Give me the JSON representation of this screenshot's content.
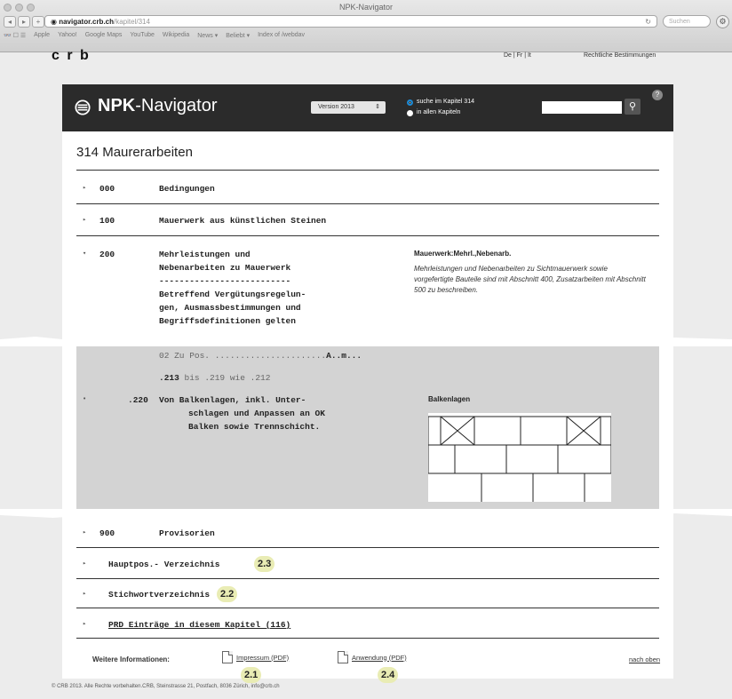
{
  "browser": {
    "window_title": "NPK-Navigator",
    "url_host": "navigator.crb.ch",
    "url_path": "/kapitel/314",
    "search_placeholder": "Suchen",
    "bookmarks": [
      "Apple",
      "Yahoo!",
      "Google Maps",
      "YouTube",
      "Wikipedia",
      "News ▾",
      "Beliebt ▾",
      "Index of /webdav"
    ]
  },
  "site": {
    "logo_text": "c r b",
    "languages": "De | Fr | It",
    "legal_link": "Rechtliche Bestimmungen"
  },
  "header": {
    "app_title_bold": "NPK",
    "app_title_rest": "-Navigator",
    "version_label": "Version 2013",
    "scope_option_1": "suche im Kapitel 314",
    "scope_option_2": "in allen Kapiteln",
    "search_value": ""
  },
  "chapter": {
    "title": "314  Maurerarbeiten",
    "rows": [
      {
        "code": "000",
        "label": "Bedingungen"
      },
      {
        "code": "100",
        "label": "Mauerwerk aus künstlichen Steinen"
      }
    ],
    "expanded": {
      "code": "200",
      "label_lines": [
        "Mehrleistungen und",
        "Nebenarbeiten zu Mauerwerk",
        "--------------------------",
        "Betreffend Vergütungsregelun-",
        "gen, Ausmassbestimmungen und",
        "Begriffsdefinitionen gelten"
      ],
      "desc_title": "Mauerwerk:Mehrl.,Nebenarb.",
      "desc_text": "Mehrleistungen und Nebenarbeiten zu Sichtmauerwerk sowie vorgefertigte Bauteile sind mit Abschnitt 400, Zusatzarbeiten mit Abschnitt 500 zu beschreiben."
    },
    "gray_block": {
      "line1_prefix": "02 Zu Pos. ......................",
      "line1_suffix": "A..m...",
      "line2_code": ".213",
      "line2_rest": "  bis .219 wie .212",
      "item_code": ".220",
      "item_lines": [
        "Von Balkenlagen, inkl. Unter-",
        "schlagen und Anpassen an OK",
        "Balken sowie Trennschicht."
      ],
      "item_desc_title": "Balkenlagen"
    },
    "more_rows": [
      {
        "code": "900",
        "label": "Provisorien"
      }
    ],
    "links": [
      {
        "label": "Hauptpos.- Verzeichnis",
        "badge": "2.3"
      },
      {
        "label": "Stichwortverzeichnis",
        "badge": "2.2"
      },
      {
        "label": "PRD Einträge in diesem Kapitel (116)",
        "badge": ""
      }
    ]
  },
  "footer": {
    "more_info_label": "Weitere Informationen:",
    "pdf1_label": "Impressum (PDF)",
    "pdf1_badge": "2.1",
    "pdf2_label": "Anwendung (PDF)",
    "pdf2_badge": "2.4",
    "top_link": "nach oben",
    "copyright": "© CRB 2013. Alle Rechte vorbehalten.CRB, Steinstrasse 21, Postfach, 8036 Zürich, info@crb.ch"
  }
}
